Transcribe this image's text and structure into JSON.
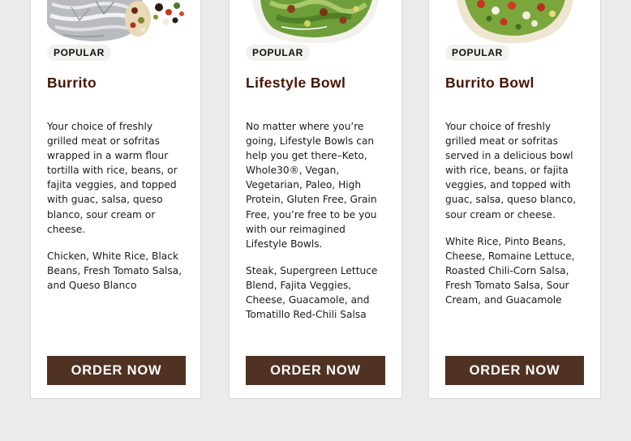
{
  "cards": [
    {
      "badge": "POPULAR",
      "title": "Burrito",
      "description": "Your choice of freshly grilled meat or sofritas wrapped in a warm flour tortilla with rice, beans, or fajita veggies, and topped with guac, salsa, queso blanco, sour cream or cheese.",
      "ingredients": "Chicken, White Rice, Black Beans, Fresh Tomato Salsa, and Queso Blanco",
      "button": "ORDER NOW",
      "image": "burrito-image"
    },
    {
      "badge": "POPULAR",
      "title": "Lifestyle Bowl",
      "description": "No matter where you’re going, Lifestyle Bowls can help you get there–Keto, Whole30®, Vegan, Vegetarian, Paleo, High Protein, Gluten Free, Grain Free, you’re free to be you with our reimagined Lifestyle Bowls.",
      "ingredients": "Steak, Supergreen Lettuce Blend, Fajita Veggies, Cheese, Guacamole, and Tomatillo Red-Chili Salsa",
      "button": "ORDER NOW",
      "image": "lifestyle-bowl-image"
    },
    {
      "badge": "POPULAR",
      "title": "Burrito Bowl",
      "description": "Your choice of freshly grilled meat or sofritas served in a delicious bowl with rice, beans, or fajita veggies, and topped with guac, salsa, queso blanco, sour cream or cheese.",
      "ingredients": "White Rice, Pinto Beans, Cheese, Romaine Lettuce, Roasted Chili-Corn Salsa, Fresh Tomato Salsa, Sour Cream, and Guacamole",
      "button": "ORDER NOW",
      "image": "burrito-bowl-image"
    }
  ],
  "colors": {
    "page_background": "#ebebeb",
    "card_background": "#ffffff",
    "title": "#451400",
    "button": "#4f3222",
    "button_text": "#ffffff",
    "badge_background": "#f2f1ee"
  }
}
